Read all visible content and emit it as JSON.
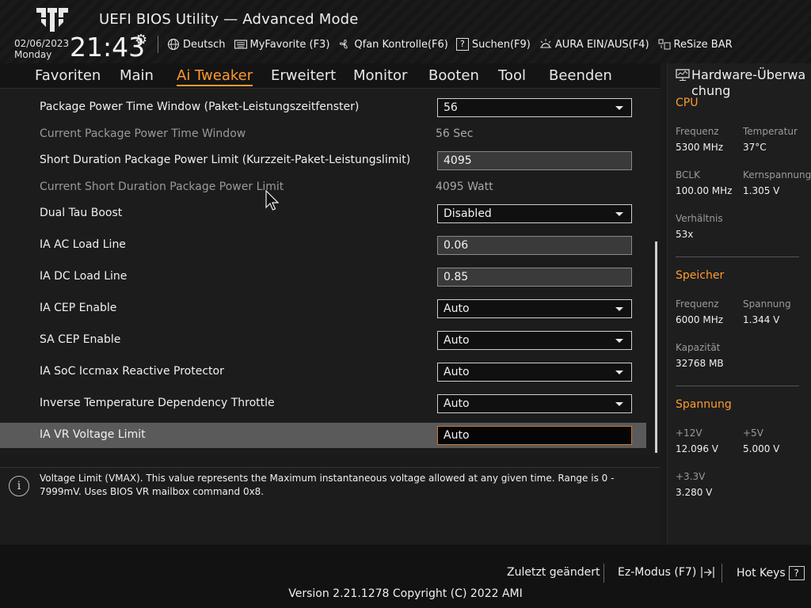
{
  "header": {
    "title": "UEFI BIOS Utility — Advanced Mode",
    "date": "02/06/2023",
    "day": "Monday",
    "time": "21:43",
    "toolbar": [
      {
        "icon": "globe-icon",
        "label": "Deutsch"
      },
      {
        "icon": "keyboard-icon",
        "label": "MyFavorite (F3)"
      },
      {
        "icon": "fan-icon",
        "label": "Qfan Kontrolle(F6)"
      },
      {
        "icon": "help-search-icon",
        "label": "Suchen(F9)"
      },
      {
        "icon": "aura-icon",
        "label": "AURA EIN/AUS(F4)"
      },
      {
        "icon": "resize-bar-icon",
        "label": "ReSize BAR"
      }
    ]
  },
  "tabs": [
    "Favoriten",
    "Main",
    "Ai Tweaker",
    "Erweitert",
    "Monitor",
    "Booten",
    "Tool",
    "Beenden"
  ],
  "active_tab": "Ai Tweaker",
  "settings": [
    {
      "label": "Package Power Time Window (Paket-Leistungszeitfenster)",
      "type": "dropdown",
      "value": "56"
    },
    {
      "label": "Current Package Power Time Window",
      "type": "info",
      "value": "56 Sec"
    },
    {
      "label": "Short Duration Package Power Limit (Kurzzeit-Paket-Leistungslimit)",
      "type": "input",
      "value": "4095"
    },
    {
      "label": "Current Short Duration Package Power Limit",
      "type": "info",
      "value": "4095 Watt"
    },
    {
      "label": "Dual Tau Boost",
      "type": "dropdown",
      "value": "Disabled"
    },
    {
      "label": "IA AC Load Line",
      "type": "input",
      "value": "0.06"
    },
    {
      "label": "IA DC Load Line",
      "type": "input",
      "value": "0.85"
    },
    {
      "label": "IA CEP Enable",
      "type": "dropdown",
      "value": "Auto"
    },
    {
      "label": "SA CEP Enable",
      "type": "dropdown",
      "value": "Auto"
    },
    {
      "label": "IA SoC Iccmax Reactive Protector",
      "type": "dropdown",
      "value": "Auto"
    },
    {
      "label": "Inverse Temperature Dependency Throttle",
      "type": "dropdown",
      "value": "Auto"
    },
    {
      "label": "IA VR Voltage Limit",
      "type": "input-selected",
      "value": "Auto"
    }
  ],
  "help_text": "Voltage Limit (VMAX). This value represents the Maximum instantaneous voltage allowed at any given time. Range is 0 - 7999mV. Uses BIOS VR mailbox command 0x8.",
  "hw_monitor": {
    "title": "Hardware-Überwachung",
    "cpu": {
      "heading": "CPU",
      "freq_label": "Frequenz",
      "freq": "5300 MHz",
      "temp_label": "Temperatur",
      "temp": "37°C",
      "bclk_label": "BCLK",
      "bclk": "100.00 MHz",
      "vcore_label": "Kernspannung",
      "vcore": "1.305 V",
      "ratio_label": "Verhältnis",
      "ratio": "53x"
    },
    "memory": {
      "heading": "Speicher",
      "freq_label": "Frequenz",
      "freq": "6000 MHz",
      "volt_label": "Spannung",
      "volt": "1.344 V",
      "cap_label": "Kapazität",
      "cap": "32768 MB"
    },
    "voltage": {
      "heading": "Spannung",
      "v12_label": "+12V",
      "v12": "12.096 V",
      "v5_label": "+5V",
      "v5": "5.000 V",
      "v33_label": "+3.3V",
      "v33": "3.280 V"
    }
  },
  "footer": {
    "last_modified": "Zuletzt geändert",
    "ez_mode": "Ez-Modus (F7)",
    "hot_keys": "Hot Keys",
    "hot_keys_key": "?",
    "version": "Version 2.21.1278 Copyright (C) 2022 AMI"
  },
  "colors": {
    "accent": "#ff9a2e",
    "background": "#1c1c1c",
    "selected_row": "#5a5a5a"
  }
}
